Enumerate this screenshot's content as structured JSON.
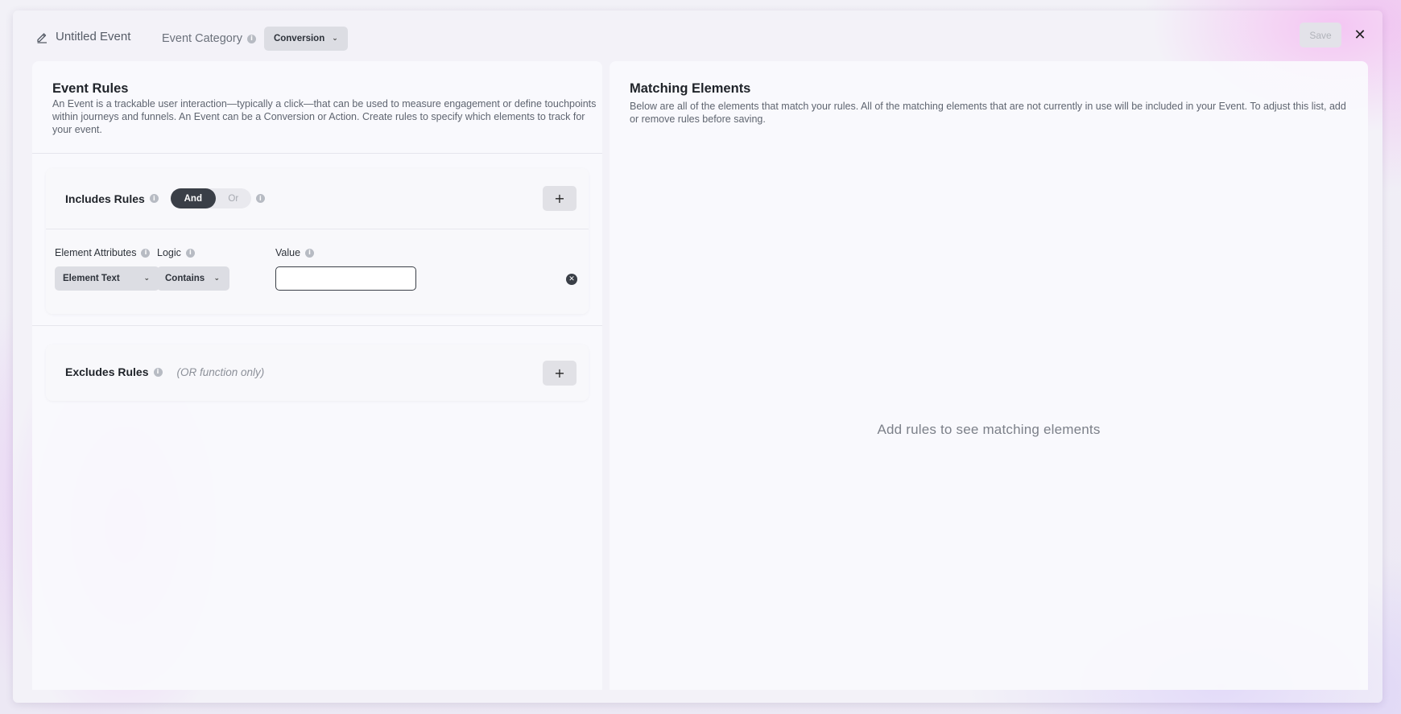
{
  "header": {
    "title": "Untitled Event",
    "category_label": "Event Category",
    "category_value": "Conversion",
    "save_label": "Save"
  },
  "left_panel": {
    "title": "Event Rules",
    "description": "An Event is a trackable user interaction—typically a click—that can be used to measure engagement or define touchpoints within journeys and funnels. An Event can be a Conversion or Action. Create rules to specify which elements to track for your event.",
    "includes": {
      "label": "Includes Rules",
      "toggle_options": [
        "And",
        "Or"
      ],
      "toggle_selected": "And",
      "rule": {
        "attributes_label": "Element Attributes",
        "attributes_value": "Element Text",
        "logic_label": "Logic",
        "logic_value": "Contains",
        "value_label": "Value",
        "value_input": ""
      }
    },
    "excludes": {
      "label": "Excludes Rules",
      "note": "(OR function only)"
    }
  },
  "right_panel": {
    "title": "Matching Elements",
    "description": "Below are all of the elements that match your rules. All of the matching elements that are not currently in use will be included in your Event. To adjust this list, add or remove rules before saving.",
    "empty_message": "Add rules to see matching elements"
  },
  "icons": {
    "title": "pencil-icon",
    "info": "info-icon",
    "chevron": "chevron-down-icon",
    "close": "close-icon",
    "add": "plus-icon",
    "remove": "remove-circle-icon"
  },
  "colors": {
    "dark": "#3a3f47",
    "select_bg": "#dcdde3",
    "muted_text": "#6b717b"
  }
}
